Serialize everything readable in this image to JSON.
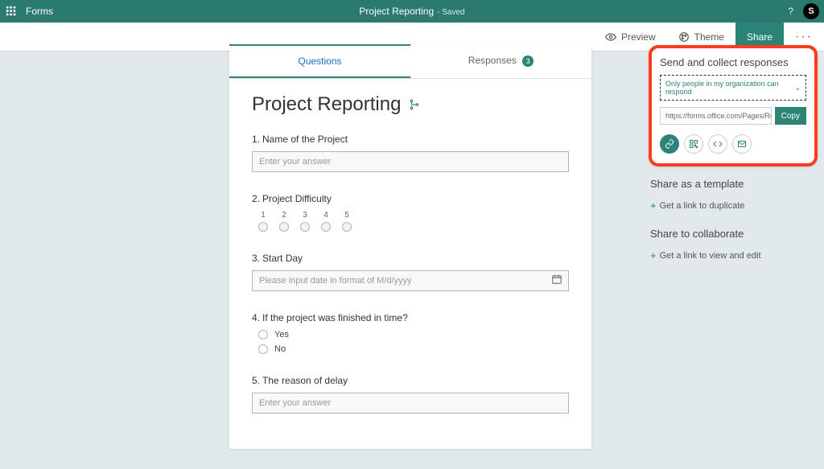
{
  "topbar": {
    "app": "Forms",
    "doc": "Project Reporting",
    "status": "- Saved",
    "avatar": "S"
  },
  "cmdbar": {
    "preview": "Preview",
    "theme": "Theme",
    "share": "Share"
  },
  "tabs": {
    "questions": "Questions",
    "responses": "Responses",
    "responses_count": "3"
  },
  "form": {
    "title": "Project Reporting",
    "questions": [
      {
        "n": "1.",
        "label": "Name of the Project",
        "type": "text",
        "placeholder": "Enter your answer"
      },
      {
        "n": "2.",
        "label": "Project Difficulty",
        "type": "rating",
        "options": [
          "1",
          "2",
          "3",
          "4",
          "5"
        ]
      },
      {
        "n": "3.",
        "label": "Start Day",
        "type": "date",
        "placeholder": "Please input date in format of M/d/yyyy"
      },
      {
        "n": "4.",
        "label": "If the project was finished in time?",
        "type": "choice",
        "options": [
          "Yes",
          "No"
        ]
      },
      {
        "n": "5.",
        "label": "The reason of delay",
        "type": "text",
        "placeholder": "Enter your answer"
      }
    ]
  },
  "share_panel": {
    "collect_title": "Send and collect responses",
    "permission": "Only people in my organization can respond",
    "link": "https://forms.office.com/Pages/Respon",
    "copy": "Copy",
    "template_title": "Share as a template",
    "template_link": "Get a link to duplicate",
    "collab_title": "Share to collaborate",
    "collab_link": "Get a link to view and edit"
  }
}
